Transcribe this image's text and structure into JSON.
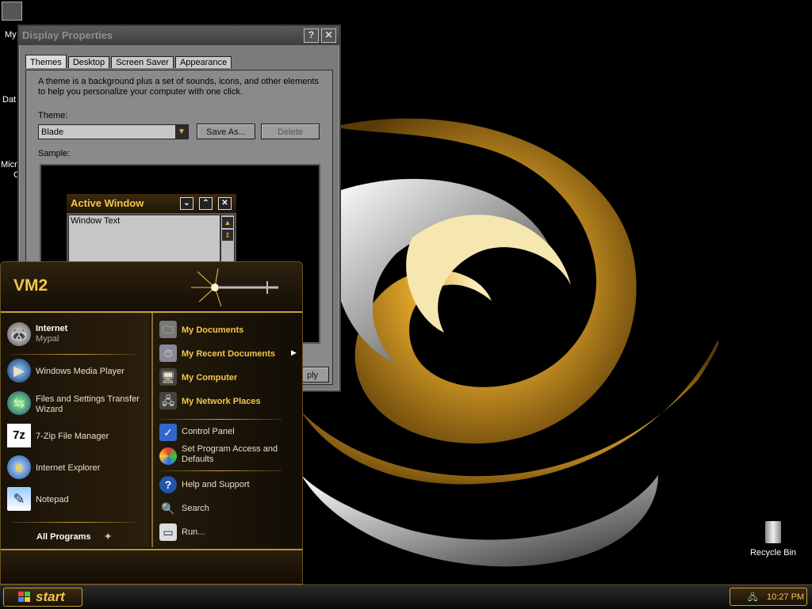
{
  "desktop": {
    "icons": [
      {
        "label": "My",
        "icon": "my-documents-icon"
      },
      {
        "label": "Dat",
        "icon": "data-icon"
      },
      {
        "label": "Micro",
        "sublabel": "C",
        "icon": "microsoft-icon"
      },
      {
        "label": "Recycle Bin",
        "icon": "recycle-bin-icon"
      }
    ]
  },
  "display_properties": {
    "title": "Display Properties",
    "help_button": "?",
    "close_button": "✕",
    "tabs": [
      "Themes",
      "Desktop",
      "Screen Saver",
      "Appearance"
    ],
    "active_tab": "Themes",
    "description": "A theme is a background plus a set of sounds, icons, and other elements to help you personalize your computer with one click.",
    "theme_label": "Theme:",
    "theme_value": "Blade",
    "save_as": "Save As...",
    "delete": "Delete",
    "sample_label": "Sample:",
    "apply_partial": "ply",
    "sample": {
      "active_window_title": "Active Window",
      "window_text": "Window Text"
    }
  },
  "start_menu": {
    "user": "VM2",
    "pinned": [
      {
        "label": "Internet",
        "sub": "Mypal",
        "icon": "mypal-icon"
      }
    ],
    "recent": [
      {
        "label": "Windows Media Player",
        "icon": "media-player-icon"
      },
      {
        "label": "Files and Settings Transfer Wizard",
        "icon": "transfer-wizard-icon"
      },
      {
        "label": "7-Zip File Manager",
        "icon": "7zip-icon"
      },
      {
        "label": "Internet Explorer",
        "icon": "internet-explorer-icon"
      },
      {
        "label": "Notepad",
        "icon": "notepad-icon"
      }
    ],
    "all_programs": "All Programs",
    "right": [
      {
        "label": "My Documents",
        "icon": "my-documents-icon"
      },
      {
        "label": "My Recent Documents",
        "icon": "recent-documents-icon"
      },
      {
        "label": "My Computer",
        "icon": "my-computer-icon"
      },
      {
        "label": "My Network Places",
        "icon": "network-places-icon"
      },
      {
        "label": "Control Panel",
        "icon": "control-panel-icon"
      },
      {
        "label": "Set Program Access and Defaults",
        "icon": "program-access-icon"
      },
      {
        "label": "Help and Support",
        "icon": "help-icon"
      },
      {
        "label": "Search",
        "icon": "search-icon"
      },
      {
        "label": "Run...",
        "icon": "run-icon"
      }
    ]
  },
  "taskbar": {
    "start_label": "start",
    "clock": "10:27 PM"
  },
  "colors": {
    "accent": "#f4c64a",
    "menu_bg": "#1c1409",
    "border_gold": "#c9a236"
  }
}
